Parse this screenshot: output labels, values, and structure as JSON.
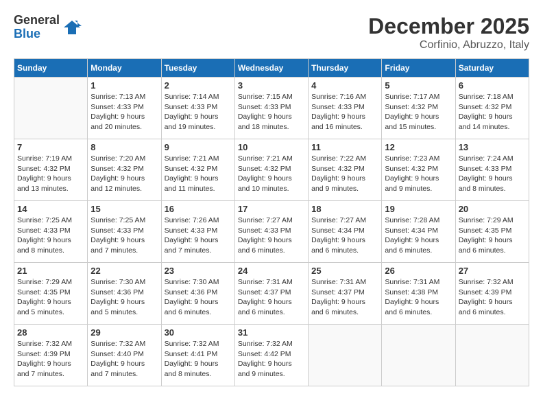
{
  "header": {
    "logo_general": "General",
    "logo_blue": "Blue",
    "month": "December 2025",
    "location": "Corfinio, Abruzzo, Italy"
  },
  "days_of_week": [
    "Sunday",
    "Monday",
    "Tuesday",
    "Wednesday",
    "Thursday",
    "Friday",
    "Saturday"
  ],
  "weeks": [
    [
      {
        "day": "",
        "sunrise": "",
        "sunset": "",
        "daylight": ""
      },
      {
        "day": "1",
        "sunrise": "Sunrise: 7:13 AM",
        "sunset": "Sunset: 4:33 PM",
        "daylight": "Daylight: 9 hours and 20 minutes."
      },
      {
        "day": "2",
        "sunrise": "Sunrise: 7:14 AM",
        "sunset": "Sunset: 4:33 PM",
        "daylight": "Daylight: 9 hours and 19 minutes."
      },
      {
        "day": "3",
        "sunrise": "Sunrise: 7:15 AM",
        "sunset": "Sunset: 4:33 PM",
        "daylight": "Daylight: 9 hours and 18 minutes."
      },
      {
        "day": "4",
        "sunrise": "Sunrise: 7:16 AM",
        "sunset": "Sunset: 4:33 PM",
        "daylight": "Daylight: 9 hours and 16 minutes."
      },
      {
        "day": "5",
        "sunrise": "Sunrise: 7:17 AM",
        "sunset": "Sunset: 4:32 PM",
        "daylight": "Daylight: 9 hours and 15 minutes."
      },
      {
        "day": "6",
        "sunrise": "Sunrise: 7:18 AM",
        "sunset": "Sunset: 4:32 PM",
        "daylight": "Daylight: 9 hours and 14 minutes."
      }
    ],
    [
      {
        "day": "7",
        "sunrise": "Sunrise: 7:19 AM",
        "sunset": "Sunset: 4:32 PM",
        "daylight": "Daylight: 9 hours and 13 minutes."
      },
      {
        "day": "8",
        "sunrise": "Sunrise: 7:20 AM",
        "sunset": "Sunset: 4:32 PM",
        "daylight": "Daylight: 9 hours and 12 minutes."
      },
      {
        "day": "9",
        "sunrise": "Sunrise: 7:21 AM",
        "sunset": "Sunset: 4:32 PM",
        "daylight": "Daylight: 9 hours and 11 minutes."
      },
      {
        "day": "10",
        "sunrise": "Sunrise: 7:21 AM",
        "sunset": "Sunset: 4:32 PM",
        "daylight": "Daylight: 9 hours and 10 minutes."
      },
      {
        "day": "11",
        "sunrise": "Sunrise: 7:22 AM",
        "sunset": "Sunset: 4:32 PM",
        "daylight": "Daylight: 9 hours and 9 minutes."
      },
      {
        "day": "12",
        "sunrise": "Sunrise: 7:23 AM",
        "sunset": "Sunset: 4:32 PM",
        "daylight": "Daylight: 9 hours and 9 minutes."
      },
      {
        "day": "13",
        "sunrise": "Sunrise: 7:24 AM",
        "sunset": "Sunset: 4:33 PM",
        "daylight": "Daylight: 9 hours and 8 minutes."
      }
    ],
    [
      {
        "day": "14",
        "sunrise": "Sunrise: 7:25 AM",
        "sunset": "Sunset: 4:33 PM",
        "daylight": "Daylight: 9 hours and 8 minutes."
      },
      {
        "day": "15",
        "sunrise": "Sunrise: 7:25 AM",
        "sunset": "Sunset: 4:33 PM",
        "daylight": "Daylight: 9 hours and 7 minutes."
      },
      {
        "day": "16",
        "sunrise": "Sunrise: 7:26 AM",
        "sunset": "Sunset: 4:33 PM",
        "daylight": "Daylight: 9 hours and 7 minutes."
      },
      {
        "day": "17",
        "sunrise": "Sunrise: 7:27 AM",
        "sunset": "Sunset: 4:33 PM",
        "daylight": "Daylight: 9 hours and 6 minutes."
      },
      {
        "day": "18",
        "sunrise": "Sunrise: 7:27 AM",
        "sunset": "Sunset: 4:34 PM",
        "daylight": "Daylight: 9 hours and 6 minutes."
      },
      {
        "day": "19",
        "sunrise": "Sunrise: 7:28 AM",
        "sunset": "Sunset: 4:34 PM",
        "daylight": "Daylight: 9 hours and 6 minutes."
      },
      {
        "day": "20",
        "sunrise": "Sunrise: 7:29 AM",
        "sunset": "Sunset: 4:35 PM",
        "daylight": "Daylight: 9 hours and 6 minutes."
      }
    ],
    [
      {
        "day": "21",
        "sunrise": "Sunrise: 7:29 AM",
        "sunset": "Sunset: 4:35 PM",
        "daylight": "Daylight: 9 hours and 5 minutes."
      },
      {
        "day": "22",
        "sunrise": "Sunrise: 7:30 AM",
        "sunset": "Sunset: 4:36 PM",
        "daylight": "Daylight: 9 hours and 5 minutes."
      },
      {
        "day": "23",
        "sunrise": "Sunrise: 7:30 AM",
        "sunset": "Sunset: 4:36 PM",
        "daylight": "Daylight: 9 hours and 6 minutes."
      },
      {
        "day": "24",
        "sunrise": "Sunrise: 7:31 AM",
        "sunset": "Sunset: 4:37 PM",
        "daylight": "Daylight: 9 hours and 6 minutes."
      },
      {
        "day": "25",
        "sunrise": "Sunrise: 7:31 AM",
        "sunset": "Sunset: 4:37 PM",
        "daylight": "Daylight: 9 hours and 6 minutes."
      },
      {
        "day": "26",
        "sunrise": "Sunrise: 7:31 AM",
        "sunset": "Sunset: 4:38 PM",
        "daylight": "Daylight: 9 hours and 6 minutes."
      },
      {
        "day": "27",
        "sunrise": "Sunrise: 7:32 AM",
        "sunset": "Sunset: 4:39 PM",
        "daylight": "Daylight: 9 hours and 6 minutes."
      }
    ],
    [
      {
        "day": "28",
        "sunrise": "Sunrise: 7:32 AM",
        "sunset": "Sunset: 4:39 PM",
        "daylight": "Daylight: 9 hours and 7 minutes."
      },
      {
        "day": "29",
        "sunrise": "Sunrise: 7:32 AM",
        "sunset": "Sunset: 4:40 PM",
        "daylight": "Daylight: 9 hours and 7 minutes."
      },
      {
        "day": "30",
        "sunrise": "Sunrise: 7:32 AM",
        "sunset": "Sunset: 4:41 PM",
        "daylight": "Daylight: 9 hours and 8 minutes."
      },
      {
        "day": "31",
        "sunrise": "Sunrise: 7:32 AM",
        "sunset": "Sunset: 4:42 PM",
        "daylight": "Daylight: 9 hours and 9 minutes."
      },
      {
        "day": "",
        "sunrise": "",
        "sunset": "",
        "daylight": ""
      },
      {
        "day": "",
        "sunrise": "",
        "sunset": "",
        "daylight": ""
      },
      {
        "day": "",
        "sunrise": "",
        "sunset": "",
        "daylight": ""
      }
    ]
  ]
}
